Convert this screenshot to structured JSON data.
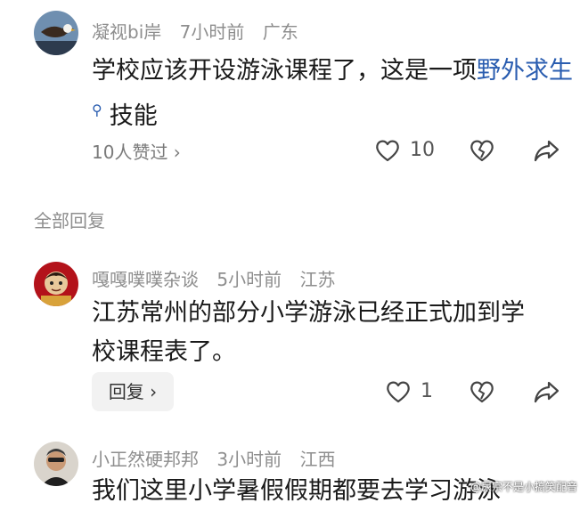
{
  "comments": [
    {
      "username": "凝视bi岸",
      "time": "7小时前",
      "location": "广东",
      "text_before": "学校应该开设游泳课程了，这是一项",
      "link_text": "野外求生",
      "text_after": "技能",
      "likes_summary": "10人赞过 ›",
      "like_count": "10"
    },
    {
      "username": "嘎嘎噗噗杂谈",
      "time": "5小时前",
      "location": "江苏",
      "text": "江苏常州的部分小学游泳已经正式加到学校课程表了。",
      "reply_label": "回复 ›",
      "like_count": "1"
    },
    {
      "username": "小正然硬邦邦",
      "time": "3小时前",
      "location": "江西",
      "text": "我们这里小学暑假假期都要去学习游泳"
    }
  ],
  "section_title": "全部回复",
  "watermark": "@尿宗不是小搞笑配音",
  "icons": {
    "like": "heart-icon",
    "dislike": "broken-heart-icon",
    "share": "share-arrow-icon",
    "search": "search-icon"
  },
  "colors": {
    "link": "#2a5db0",
    "meta": "#8e8e8e"
  }
}
